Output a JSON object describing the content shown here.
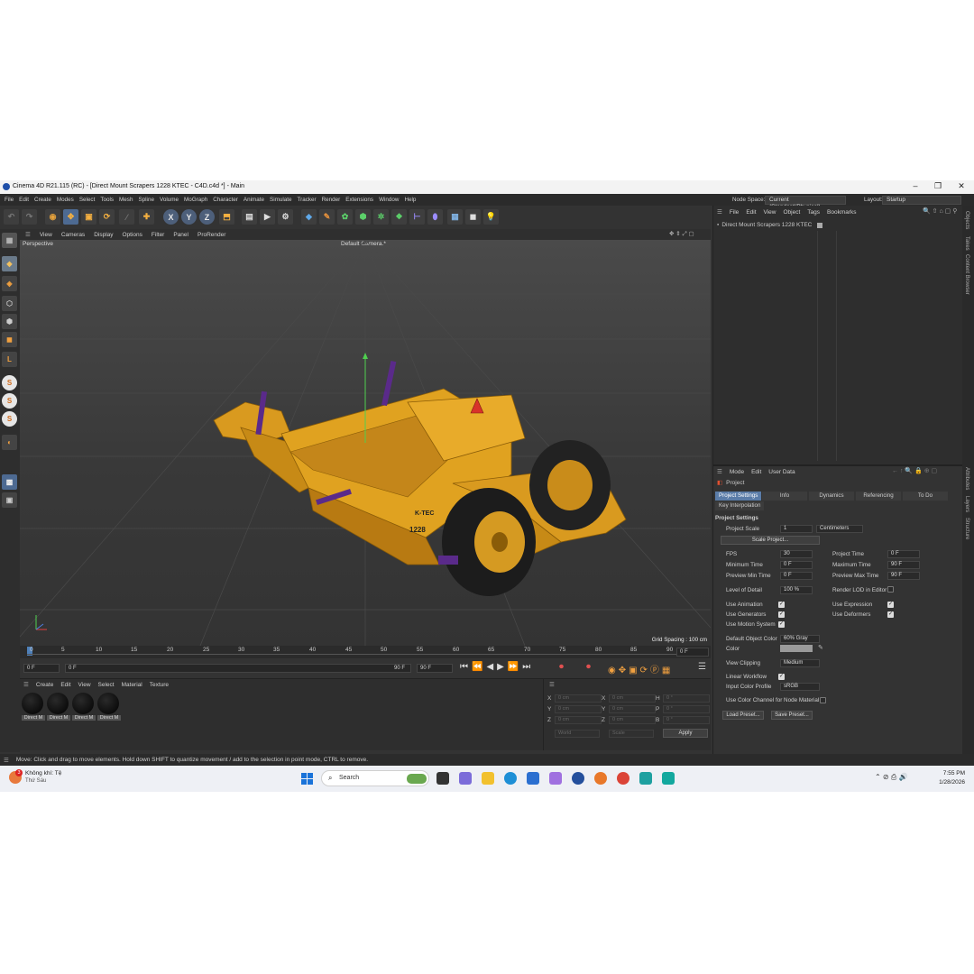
{
  "window": {
    "title": "Cinema 4D R21.115 (RC) - [Direct Mount Scrapers 1228 KTEC - C4D.c4d *] - Main",
    "min": "–",
    "max": "❐",
    "close": "✕"
  },
  "menu": [
    "File",
    "Edit",
    "Create",
    "Modes",
    "Select",
    "Tools",
    "Mesh",
    "Spline",
    "Volume",
    "MoGraph",
    "Character",
    "Animate",
    "Simulate",
    "Tracker",
    "Render",
    "Extensions",
    "Window",
    "Help"
  ],
  "node_space": {
    "label": "Node Space:",
    "value": "Current (Standard/Physical)"
  },
  "layout": {
    "label": "Layout:",
    "value": "Startup"
  },
  "toolbar": {
    "x": "X",
    "y": "Y",
    "z": "Z"
  },
  "viewport": {
    "menu": [
      "View",
      "Cameras",
      "Display",
      "Options",
      "Filter",
      "Panel",
      "ProRender"
    ],
    "name": "Perspective",
    "camera": "Default Camera",
    "camera_suffix": ".*",
    "grid_spacing": "Grid Spacing : 100 cm",
    "decal_brand": "K-TEC",
    "decal_model": "1228"
  },
  "timeline": {
    "ticks": [
      "0",
      "5",
      "10",
      "15",
      "20",
      "25",
      "30",
      "35",
      "40",
      "45",
      "50",
      "55",
      "60",
      "65",
      "70",
      "75",
      "80",
      "85",
      "90"
    ],
    "current": "0 F",
    "start": "0 F",
    "preview_start": "0 F",
    "preview_end": "90 F",
    "end": "90 F"
  },
  "material_manager": {
    "menu": [
      "Create",
      "Edit",
      "View",
      "Select",
      "Material",
      "Texture"
    ],
    "materials": [
      "Direct M",
      "Direct M",
      "Direct M",
      "Direct M"
    ]
  },
  "coordinates": {
    "rows": [
      {
        "a": "X",
        "av": "0 cm",
        "b": "X",
        "bv": "0 cm",
        "c": "H",
        "cv": "0 °"
      },
      {
        "a": "Y",
        "av": "0 cm",
        "b": "Y",
        "bv": "0 cm",
        "c": "P",
        "cv": "0 °"
      },
      {
        "a": "Z",
        "av": "0 cm",
        "b": "Z",
        "bv": "0 cm",
        "c": "B",
        "cv": "0 °"
      }
    ],
    "mode1": "World",
    "mode2": "Scale",
    "apply": "Apply"
  },
  "status": "Move: Click and drag to move elements. Hold down SHIFT to quantize movement / add to the selection in point mode, CTRL to remove.",
  "objects": {
    "menu": [
      "File",
      "Edit",
      "View",
      "Object",
      "Tags",
      "Bookmarks"
    ],
    "item": "Direct Mount Scrapers 1228 KTEC"
  },
  "right_tabs": [
    "Objects",
    "Takes",
    "Content Browser",
    "Attributes",
    "Layers",
    "Structure"
  ],
  "attributes": {
    "menu": [
      "Mode",
      "Edit",
      "User Data"
    ],
    "object": "Project",
    "tabs": [
      "Project Settings",
      "Info",
      "Dynamics",
      "Referencing",
      "To Do"
    ],
    "tab2": "Key Interpolation",
    "section": "Project Settings",
    "project_scale": {
      "label": "Project Scale",
      "value": "1",
      "unit": "Centimeters"
    },
    "scale_button": "Scale Project...",
    "fps": {
      "label": "FPS",
      "value": "30"
    },
    "project_time": {
      "label": "Project Time",
      "value": "0 F"
    },
    "min_time": {
      "label": "Minimum Time",
      "value": "0 F"
    },
    "max_time": {
      "label": "Maximum Time",
      "value": "90 F"
    },
    "preview_min": {
      "label": "Preview Min Time",
      "value": "0 F"
    },
    "preview_max": {
      "label": "Preview Max Time",
      "value": "90 F"
    },
    "lod": {
      "label": "Level of Detail",
      "value": "100 %"
    },
    "render_lod": "Render LOD in Editor",
    "use_animation": "Use Animation",
    "use_expression": "Use Expression",
    "use_generators": "Use Generators",
    "use_deformers": "Use Deformers",
    "use_motion": "Use Motion System",
    "default_color": {
      "label": "Default Object Color",
      "value": "60% Gray"
    },
    "color": "Color",
    "view_clipping": {
      "label": "View Clipping",
      "value": "Medium"
    },
    "linear_workflow": "Linear Workflow",
    "input_color": {
      "label": "Input Color Profile",
      "value": "sRGB"
    },
    "use_color_channel": "Use Color Channel for Node Material",
    "load_preset": "Load Preset...",
    "save_preset": "Save Preset..."
  },
  "taskbar": {
    "weather_title": "Không khí: Tệ",
    "weather_sub": "Thứ Sáu",
    "badge": "3",
    "search": "Search",
    "time": "7:55 PM",
    "date": "1/28/2026"
  }
}
